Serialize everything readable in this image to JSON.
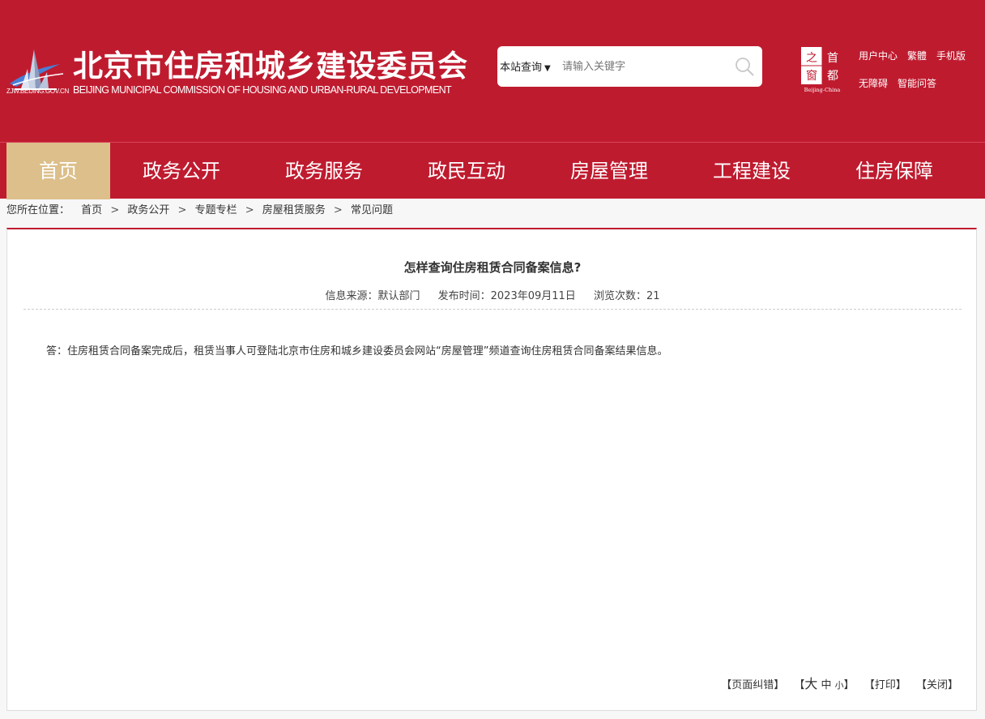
{
  "header": {
    "title": "北京市住房和城乡建设委员会",
    "subtitle": "BEIJING MUNICIPAL COMMISSION OF HOUSING AND URBAN-RURAL DEVELOPMENT",
    "domain": "ZJW.BEIJING.GOV.CN",
    "brand_color": "#bf1b2f",
    "window_logo": {
      "chars": [
        "之",
        "首",
        "窗",
        "都"
      ],
      "caption": "Beijing-China"
    },
    "links": [
      "用户中心",
      "繁體",
      "手机版",
      "无障碍",
      "智能问答"
    ]
  },
  "search": {
    "scope": "本站查询",
    "placeholder": "请输入关键字",
    "icon": "search-icon"
  },
  "nav": {
    "active_color": "#dcbf8a",
    "items": [
      {
        "label": "首页"
      },
      {
        "label": "政务公开"
      },
      {
        "label": "政务服务"
      },
      {
        "label": "政民互动"
      },
      {
        "label": "房屋管理"
      },
      {
        "label": "工程建设"
      },
      {
        "label": "住房保障"
      }
    ]
  },
  "breadcrumb": {
    "prefix": "您所在位置：",
    "items": [
      "首页",
      "政务公开",
      "专题专栏",
      "房屋租赁服务",
      "常见问题"
    ],
    "separator": ">"
  },
  "article": {
    "title": "怎样查询住房租赁合同备案信息?",
    "source": "信息来源：默认部门",
    "published": "发布时间：2023年09月11日",
    "views": "浏览次数：21",
    "body": "答：住房租赁合同备案完成后，租赁当事人可登陆北京市住房和城乡建设委员会网站“房屋管理”频道查询住房租赁合同备案结果信息。"
  },
  "tools": {
    "correction": "【页面纠错】",
    "size_open": "【",
    "size_large": "大",
    "size_medium": "中",
    "size_small": "小",
    "size_close": "】",
    "print": "【打印】",
    "close": "【关闭】"
  }
}
